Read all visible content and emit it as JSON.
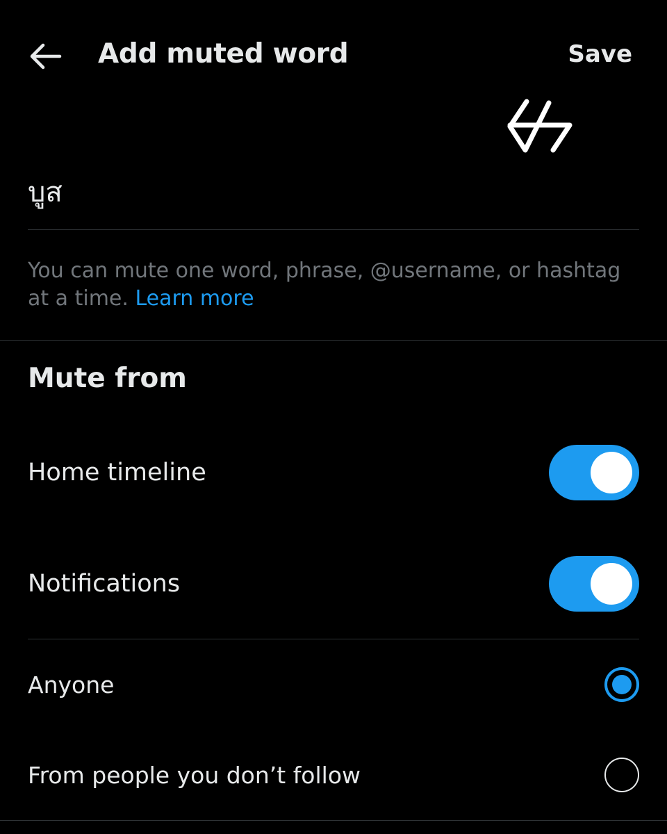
{
  "header": {
    "title": "Add muted word",
    "save_label": "Save",
    "back_icon": "arrow-left-icon"
  },
  "logo": {
    "name": "handwritten-logo"
  },
  "word_input": {
    "value": "บูส"
  },
  "helper": {
    "text": "You can mute one word, phrase, @username, or hashtag at a time. ",
    "link": "Learn more"
  },
  "mute_from": {
    "title": "Mute from",
    "home_timeline": {
      "label": "Home timeline",
      "enabled": true
    },
    "notifications": {
      "label": "Notifications",
      "enabled": true
    }
  },
  "audience": {
    "anyone": {
      "label": "Anyone",
      "selected": true
    },
    "non_followers": {
      "label": "From people you don’t follow",
      "selected": false
    }
  },
  "colors": {
    "background": "#000000",
    "accent": "#1d9bf0",
    "text": "#e7e9ea",
    "muted_text": "#71767b",
    "divider": "#2f3336"
  }
}
